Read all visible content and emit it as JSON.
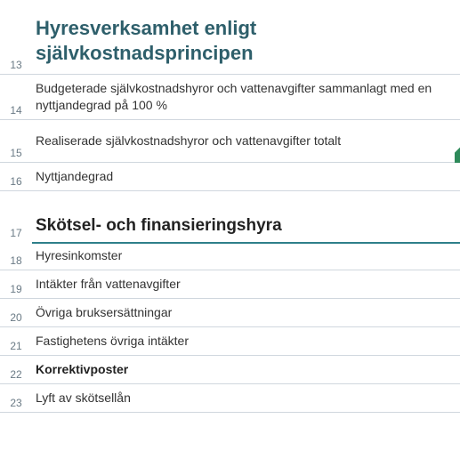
{
  "rows": {
    "13": {
      "num": "13",
      "text": "Hyresverksamhet enligt självkostnadsprincipen"
    },
    "14": {
      "num": "14",
      "text": "Budgeterade självkostnadshyror och vattenavgifter sammanlagt med en nyttjandegrad på 100 %"
    },
    "15": {
      "num": "15",
      "text": "Realiserade självkostnadshyror och vattenavgifter totalt"
    },
    "16": {
      "num": "16",
      "text": "Nyttjandegrad"
    },
    "17": {
      "num": "17",
      "text": "Skötsel- och finansieringshyra"
    },
    "18": {
      "num": "18",
      "text": "Hyresinkomster"
    },
    "19": {
      "num": "19",
      "text": "Intäkter från vattenavgifter"
    },
    "20": {
      "num": "20",
      "text": "Övriga bruksersättningar"
    },
    "21": {
      "num": "21",
      "text": "Fastighetens övriga intäkter"
    },
    "22": {
      "num": "22",
      "text": "Korrektivposter"
    },
    "23": {
      "num": "23",
      "text": "Lyft av skötsellån"
    }
  }
}
